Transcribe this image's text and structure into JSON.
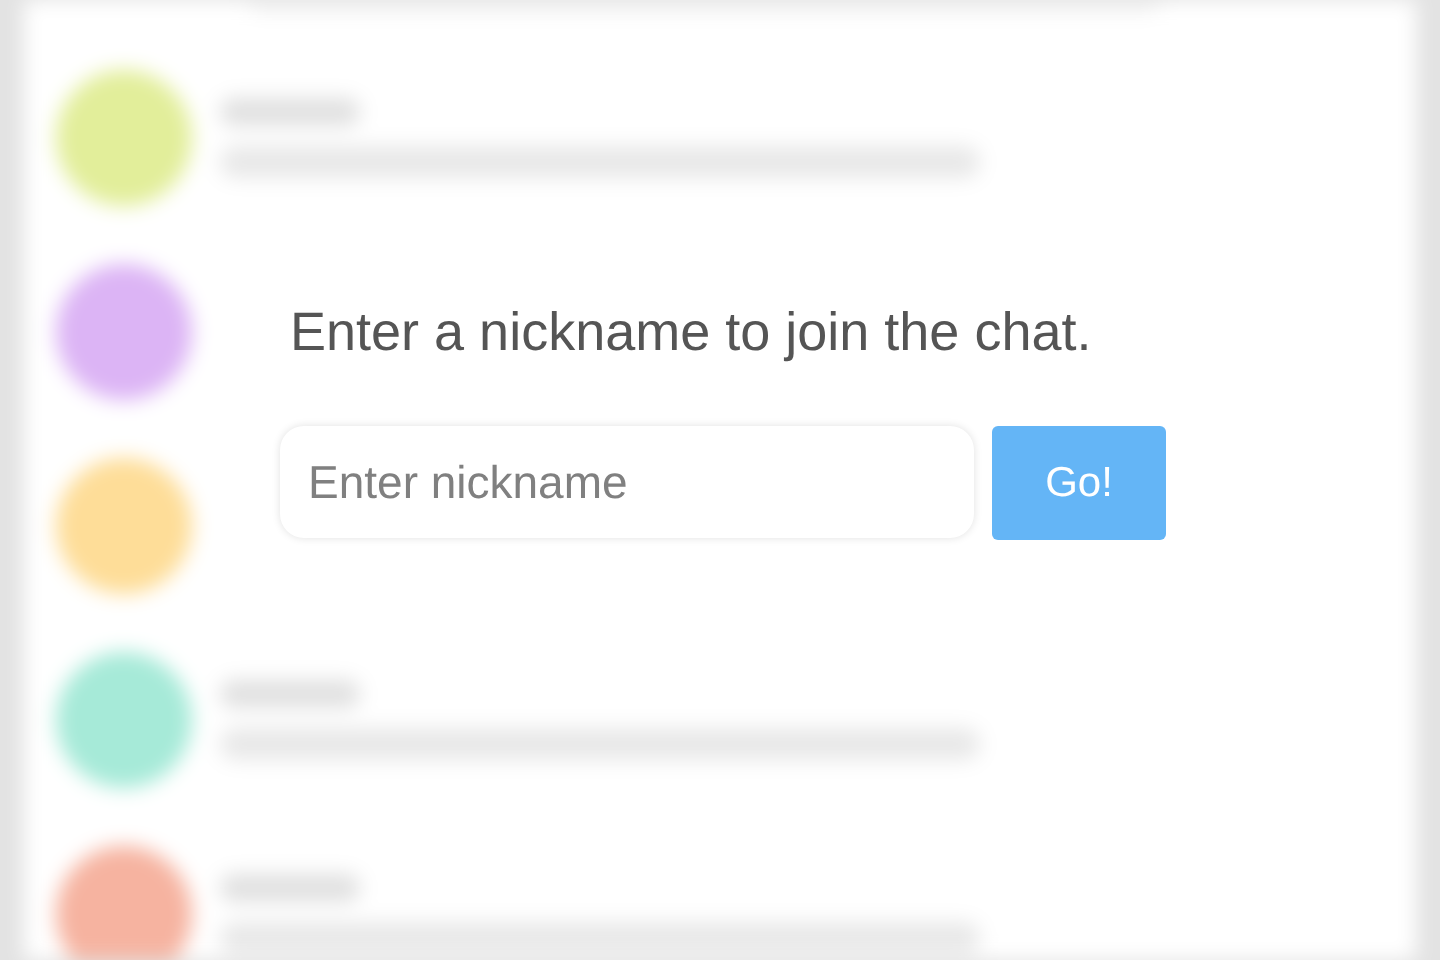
{
  "background_rows": [
    {
      "color": "#e2ee9a"
    },
    {
      "color": "#dcb4f5"
    },
    {
      "color": "#fedd98"
    },
    {
      "color": "#a6ead8"
    },
    {
      "color": "#f6b3a0"
    }
  ],
  "join_prompt": {
    "message": "Enter a nickname to join the chat.",
    "nickname_field": {
      "placeholder": "Enter nickname"
    },
    "go_button": "Go!"
  }
}
